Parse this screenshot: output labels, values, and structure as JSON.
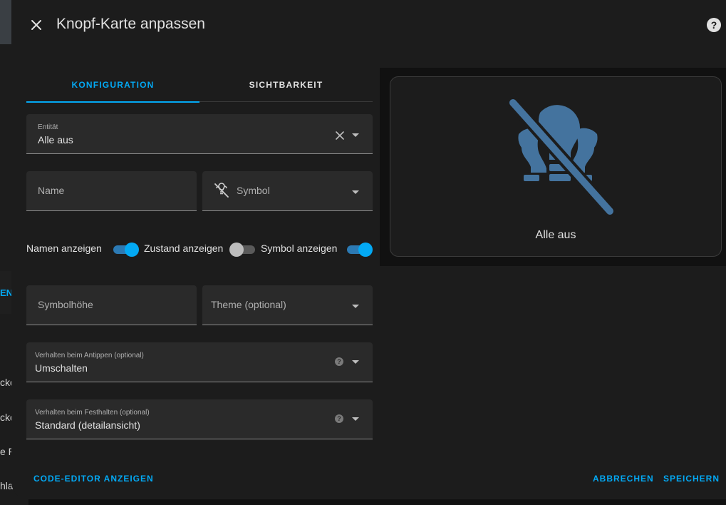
{
  "background": {
    "fragments": [
      "ckd",
      "ckd",
      "e Fa",
      "hla:"
    ],
    "accent_fragment": "EN"
  },
  "dialog": {
    "title": "Knopf-Karte anpassen",
    "close_icon": "close-icon",
    "help_icon": "help-circle-icon"
  },
  "tabs": [
    {
      "label": "KONFIGURATION",
      "active": true
    },
    {
      "label": "SICHTBARKEIT",
      "active": false
    }
  ],
  "form": {
    "entity": {
      "label": "Entität",
      "value": "Alle aus"
    },
    "name": {
      "placeholder": "Name"
    },
    "symbol": {
      "placeholder": "Symbol",
      "icon": "lightbulb-group-off-icon"
    },
    "toggles": [
      {
        "label": "Namen anzeigen",
        "on": true
      },
      {
        "label": "Zustand anzeigen",
        "on": false
      },
      {
        "label": "Symbol anzeigen",
        "on": true
      }
    ],
    "icon_height": {
      "placeholder": "Symbolhöhe"
    },
    "theme": {
      "placeholder": "Theme (optional)"
    },
    "tap_action": {
      "label": "Verhalten beim Antippen (optional)",
      "value": "Umschalten"
    },
    "hold_action": {
      "label": "Verhalten beim Festhalten (optional)",
      "value": "Standard (detailansicht)"
    }
  },
  "preview": {
    "name": "Alle aus",
    "icon": "lightbulb-group-off-icon",
    "icon_color": "#44739e"
  },
  "footer": {
    "code_editor": "CODE-EDITOR ANZEIGEN",
    "cancel": "ABBRECHEN",
    "save": "SPEICHERN"
  },
  "colors": {
    "accent": "#03a9f4",
    "surface": "#1c1c1c",
    "field": "#2a2a2a"
  }
}
